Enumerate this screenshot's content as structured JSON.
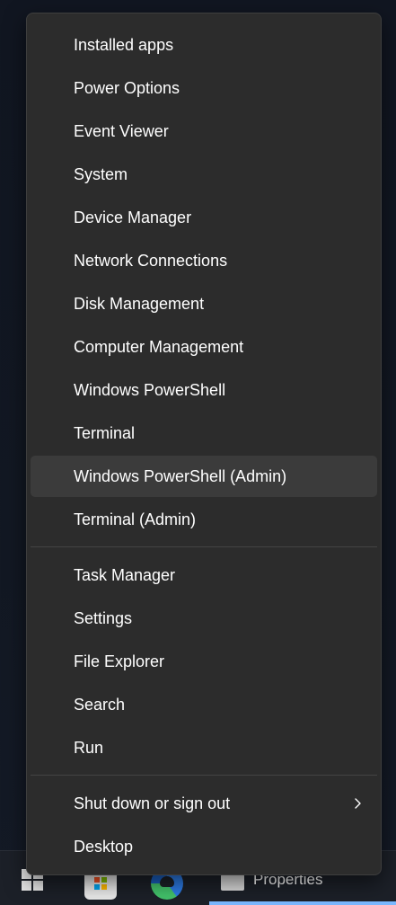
{
  "menu": {
    "group1": [
      {
        "label": "Installed apps"
      },
      {
        "label": "Power Options"
      },
      {
        "label": "Event Viewer"
      },
      {
        "label": "System"
      },
      {
        "label": "Device Manager"
      },
      {
        "label": "Network Connections"
      },
      {
        "label": "Disk Management"
      },
      {
        "label": "Computer Management"
      },
      {
        "label": "Windows PowerShell"
      },
      {
        "label": "Terminal"
      },
      {
        "label": "Windows PowerShell (Admin)",
        "highlighted": true
      },
      {
        "label": "Terminal (Admin)"
      }
    ],
    "group2": [
      {
        "label": "Task Manager"
      },
      {
        "label": "Settings"
      },
      {
        "label": "File Explorer"
      },
      {
        "label": "Search"
      },
      {
        "label": "Run"
      }
    ],
    "group3": [
      {
        "label": "Shut down or sign out",
        "submenu_icon": "chevron-right-icon"
      },
      {
        "label": "Desktop"
      }
    ]
  },
  "taskbar": {
    "items": [
      {
        "icon": "windows-start-icon"
      },
      {
        "icon": "microsoft-store-icon"
      },
      {
        "icon": "edge-browser-icon"
      },
      {
        "icon": "properties-window-icon",
        "label": "Properties",
        "active": true
      }
    ]
  },
  "colors": {
    "menu_bg": "#2c2c2c",
    "highlight": "#3b3b3b",
    "text": "#ffffff",
    "accent": "#7ab8ff"
  }
}
